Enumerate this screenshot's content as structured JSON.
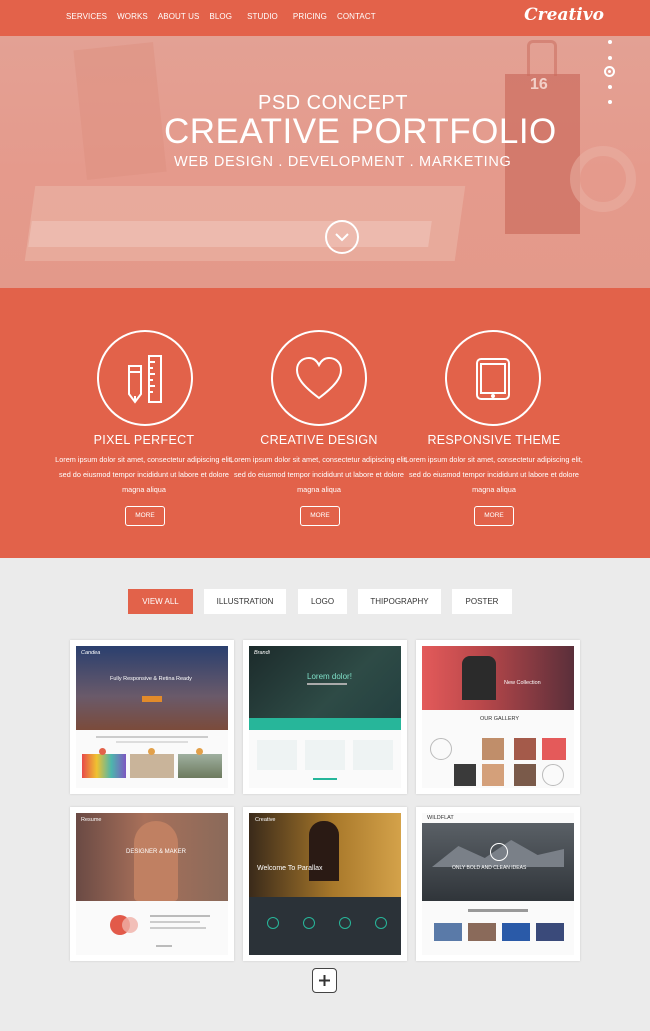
{
  "nav": {
    "items": [
      "SERVICES",
      "WORKS",
      "ABOUT US",
      "BLOG",
      "STUDIO",
      "PRICING",
      "CONTACT"
    ],
    "logo": "Creativo"
  },
  "hero": {
    "kicker": "PSD CONCEPT",
    "title": "CREATIVE PORTFOLIO",
    "subtitle": "WEB DESIGN . DEVELOPMENT . MARKETING",
    "bg_number": "16",
    "slider_dots": 5,
    "active_dot": 3
  },
  "features": [
    {
      "icon": "pencil-ruler-icon",
      "title": "PIXEL PERFECT",
      "text": "Lorem ipsum dolor sit amet, consectetur adipiscing elit, sed do eiusmod tempor incididunt ut labore et dolore magna aliqua",
      "button": "MORE"
    },
    {
      "icon": "heart-icon",
      "title": "CREATIVE DESIGN",
      "text": "Lorem ipsum dolor sit amet, consectetur adipiscing elit, sed do eiusmod tempor incididunt ut labore et dolore magna aliqua",
      "button": "MORE"
    },
    {
      "icon": "tablet-icon",
      "title": "RESPONSIVE THEME",
      "text": "Lorem ipsum dolor sit amet, consectetur adipiscing elit, sed do eiusmod tempor incididunt ut labore et dolore magna aliqua",
      "button": "MORE"
    }
  ],
  "filters": [
    "VIEW ALL",
    "ILLUSTRATION",
    "LOGO",
    "THIPOGRAPHY",
    "POSTER"
  ],
  "active_filter": "VIEW ALL",
  "portfolio": [
    {
      "headline": "Fully Responsive & Retina Ready",
      "brand": "Candea"
    },
    {
      "headline": "Lorem dolor!",
      "brand": "Brandi"
    },
    {
      "headline": "New Collection",
      "brand": "OUR GALLERY"
    },
    {
      "headline": "DESIGNER & MAKER",
      "brand": "Resume"
    },
    {
      "headline": "Welcome To Parallax",
      "brand": "Creative"
    },
    {
      "headline": "ONLY BOLD AND CLEAN IDEAS",
      "brand": "WILDFLAT"
    }
  ],
  "load_more_icon": "plus-icon",
  "colors": {
    "accent": "#e2624a",
    "hero_tint": "#e59a8c",
    "background": "#ebebeb"
  }
}
